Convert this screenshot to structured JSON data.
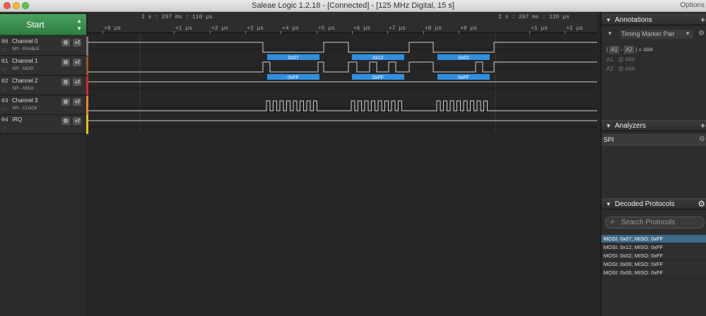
{
  "window": {
    "title": "Saleae Logic 1.2.18 - [Connected] - [125 MHz Digital, 15 s]",
    "options_label": "Options"
  },
  "start": {
    "label": "Start"
  },
  "channels": [
    {
      "num": "00",
      "name": "Channel 0",
      "sub": "SPI - ENABLE",
      "color": "#7a7a7a"
    },
    {
      "num": "01",
      "name": "Channel 1",
      "sub": "SPI - MOSI",
      "color": "#a0522d"
    },
    {
      "num": "02",
      "name": "Channel 2",
      "sub": "SPI - MISO",
      "color": "#d22a2a"
    },
    {
      "num": "03",
      "name": "Channel 3",
      "sub": "SPI - CLOCK",
      "color": "#e8862a"
    },
    {
      "num": "04",
      "name": "IRQ",
      "sub": "",
      "color": "#e6c21a"
    }
  ],
  "ruler": {
    "timestamp_left": "2 s : 297 ms : 110 µs",
    "timestamp_right": "2 s : 297 ms : 120 µs",
    "ticks": [
      "+9 µs",
      "+1 µs",
      "+2 µs",
      "+3 µs",
      "+4 µs",
      "+5 µs",
      "+6 µs",
      "+7 µs",
      "+8 µs",
      "+9 µs",
      "+1 µs",
      "+2 µs"
    ]
  },
  "decoded_bubbles": {
    "mosi": [
      "0x07",
      "0x12",
      "0x02"
    ],
    "miso": [
      "0xFF",
      "0xFF",
      "0xFF"
    ]
  },
  "colors": {
    "accent_blue": "#2f8fe0",
    "selection_blue": "#3e6a8c",
    "start_green": "#3c9250"
  },
  "annotations": {
    "title": "Annotations",
    "marker_pair": "Timing Marker Pair",
    "a1": "A1",
    "a2": "A2",
    "diff_value": "= ###",
    "a1_value": "@ ###",
    "a2_value": "@ ###"
  },
  "analyzers": {
    "title": "Analyzers",
    "items": [
      "SPI"
    ]
  },
  "decoded_protocols": {
    "title": "Decoded Protocols",
    "search_placeholder": "Search Protocols",
    "rows": [
      "MOSI: 0x07;  MISO: 0xFF",
      "MOSI: 0x12;  MISO: 0xFF",
      "MOSI: 0x02;  MISO: 0xFF",
      "MOSI: 0x00;  MISO: 0xFF",
      "MOSI: 0x00;  MISO: 0xFF"
    ]
  }
}
